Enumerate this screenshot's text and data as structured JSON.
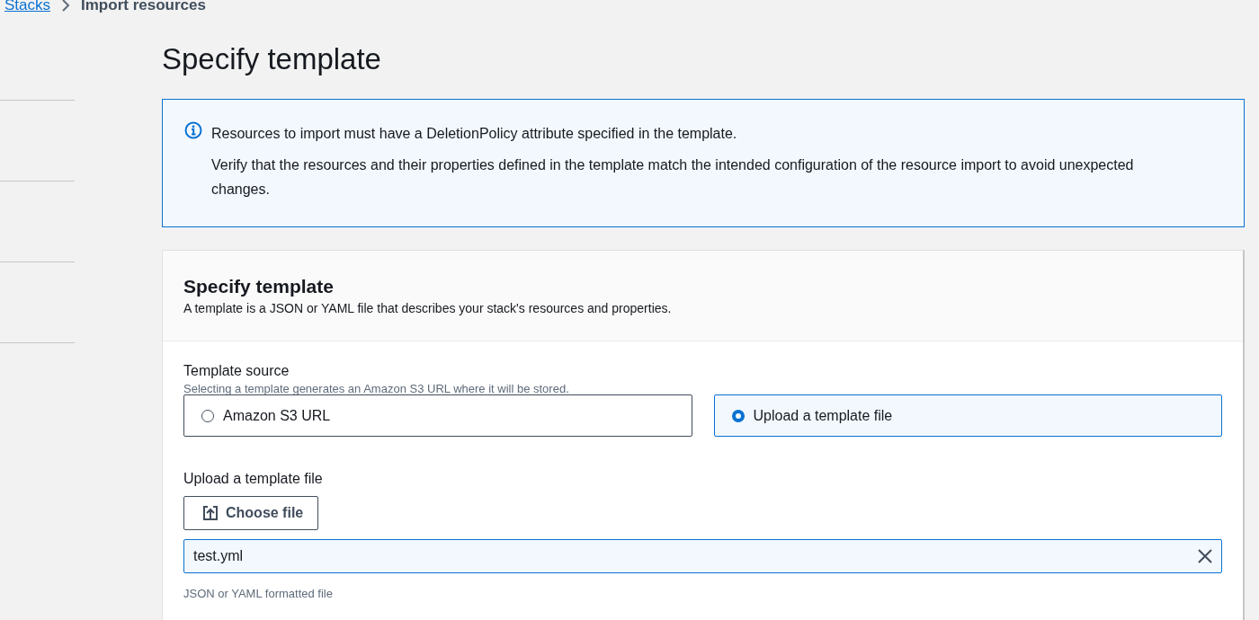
{
  "breadcrumb": [
    {
      "label": "Stacks",
      "link": true
    },
    {
      "label": "Import resources",
      "link": false
    }
  ],
  "page_title": "Specify template",
  "alert": {
    "lines": [
      "Resources to import must have a DeletionPolicy attribute specified in the template.",
      "Verify that the resources and their properties defined in the template match the intended configuration of the resource import to avoid unexpected changes."
    ]
  },
  "card": {
    "title": "Specify template",
    "description": "A template is a JSON or YAML file that describes your stack's resources and properties.",
    "source": {
      "label": "Template source",
      "hint": "Selecting a template generates an Amazon S3 URL where it will be stored.",
      "options": [
        {
          "label": "Amazon S3 URL",
          "selected": false
        },
        {
          "label": "Upload a template file",
          "selected": true
        }
      ]
    },
    "upload": {
      "label": "Upload a template file",
      "button": "Choose file",
      "value": "test.yml",
      "hint": "JSON or YAML formatted file"
    }
  }
}
